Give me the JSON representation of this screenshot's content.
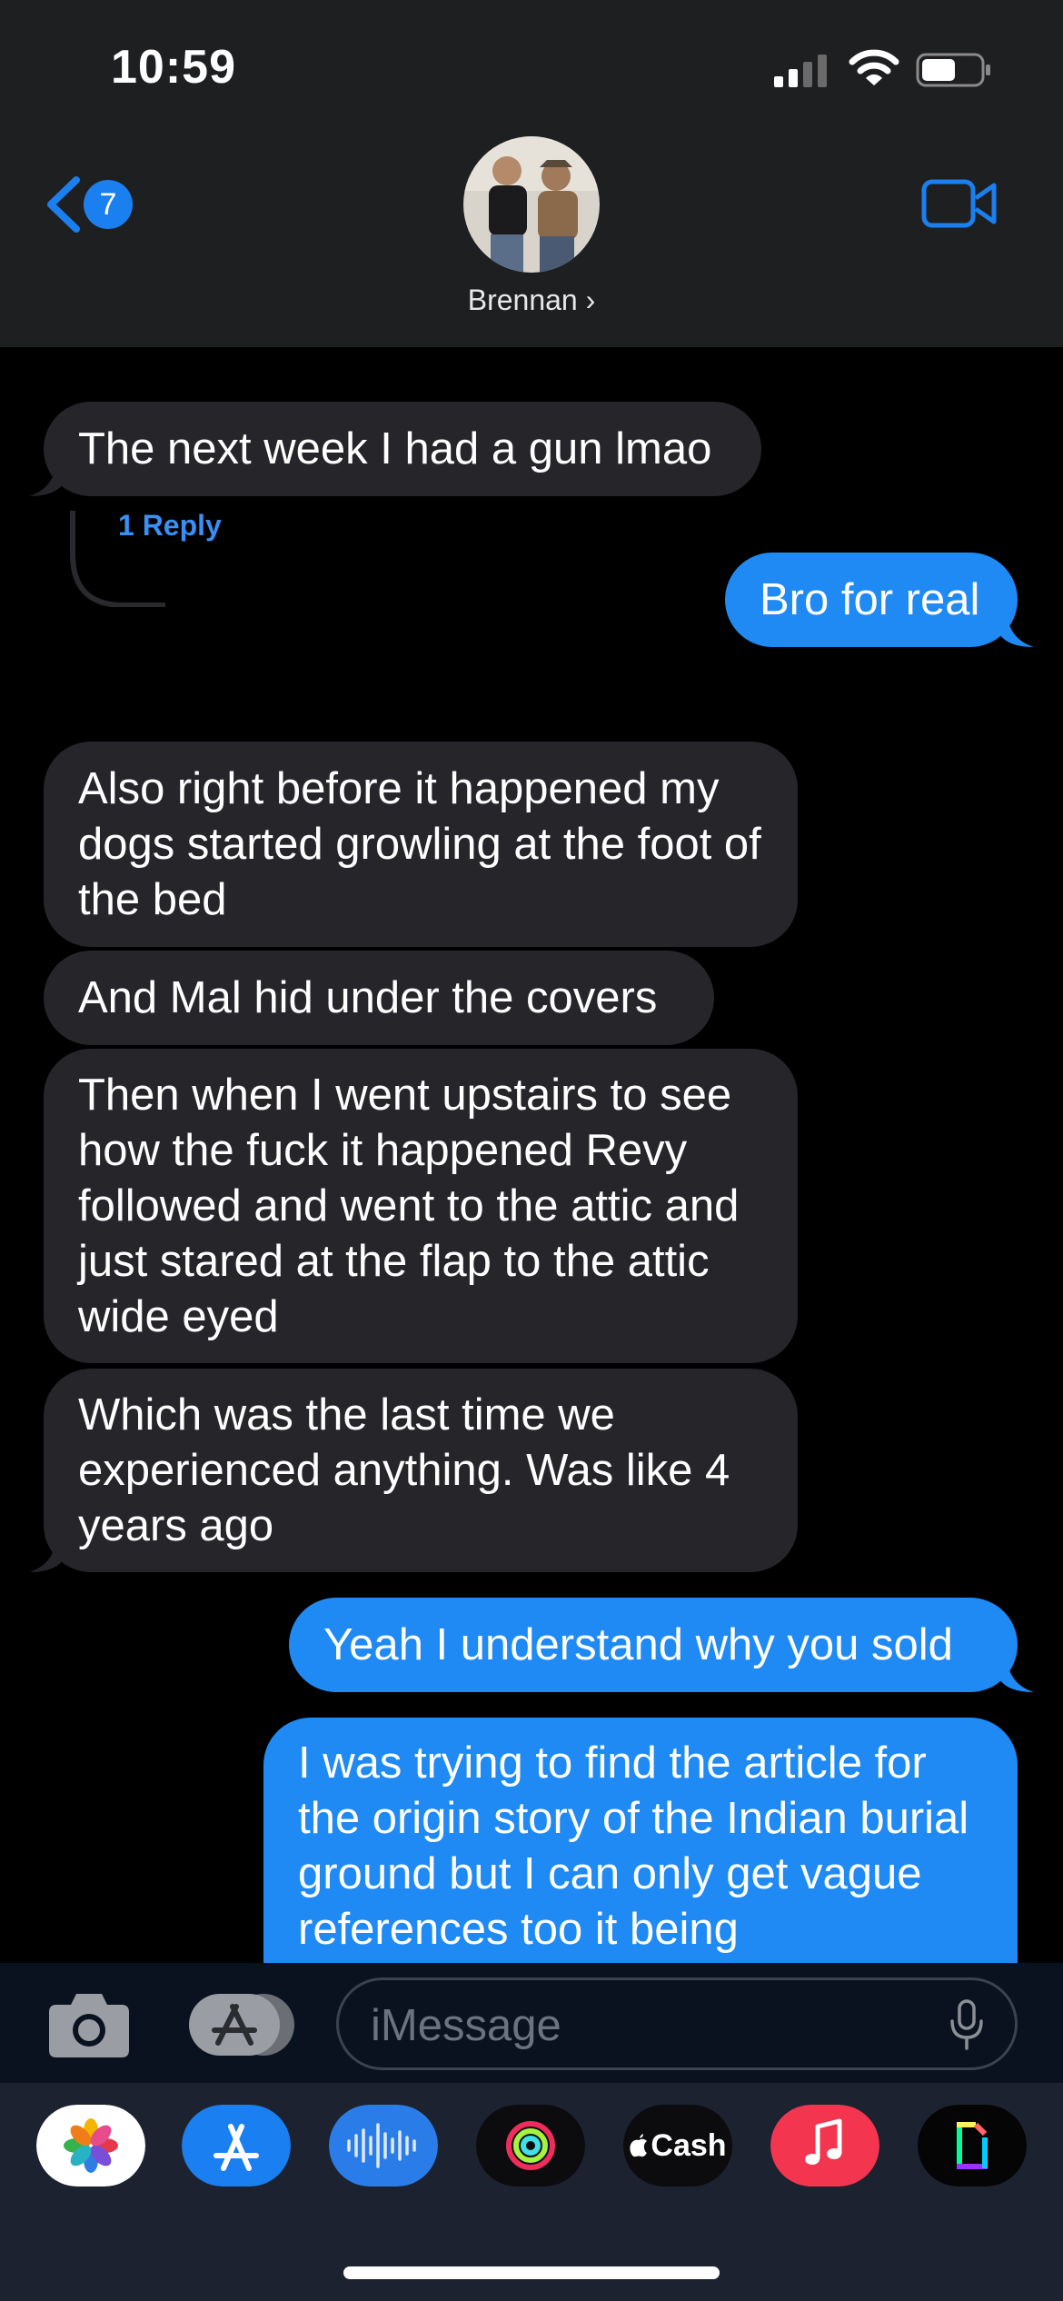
{
  "status_bar": {
    "time": "10:59"
  },
  "header": {
    "back_badge": "7",
    "contact_name": "Brennan ›"
  },
  "messages": [
    {
      "dir": "in",
      "text": "The next week I had a gun lmao"
    },
    {
      "dir": "out",
      "text": "Bro for real"
    },
    {
      "dir": "in",
      "text": "Also right before it happened my dogs started growling at the foot of the bed"
    },
    {
      "dir": "in",
      "text": "And Mal hid under the covers"
    },
    {
      "dir": "in",
      "text": "Then when I went upstairs to see how the fuck it happened Revy followed and went to the attic and just stared at the flap to the attic wide eyed"
    },
    {
      "dir": "in",
      "text": "Which was the last time we experienced anything. Was like 4 years ago"
    },
    {
      "dir": "out",
      "text": "Yeah I understand why you sold"
    },
    {
      "dir": "out",
      "text": "I was trying to find the article for the origin story of the Indian burial ground but I can only get vague references too it being"
    }
  ],
  "reply_label": "1 Reply",
  "composer": {
    "placeholder": "iMessage"
  },
  "dock": {
    "cash_label": "Cash"
  },
  "colors": {
    "incoming": "#26252a",
    "outgoing": "#1f8af4",
    "accent": "#1a80f0"
  }
}
